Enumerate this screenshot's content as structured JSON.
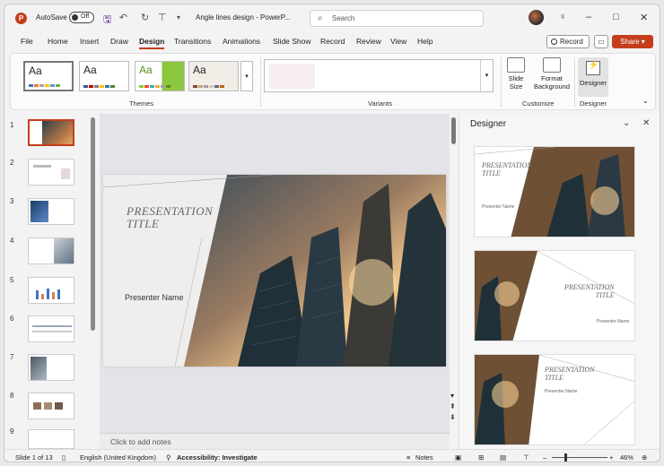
{
  "titlebar": {
    "autosave_label": "AutoSave",
    "autosave_state": "Off",
    "doc_title": "Angle lines design - PowerP...",
    "search_placeholder": "Search",
    "minimize": "–",
    "maximize": "□",
    "close": "✕"
  },
  "tabs": [
    "File",
    "Home",
    "Insert",
    "Draw",
    "Design",
    "Transitions",
    "Animations",
    "Slide Show",
    "Record",
    "Review",
    "View",
    "Help"
  ],
  "active_tab": "Design",
  "actions": {
    "record": "Record",
    "share": "Share"
  },
  "ribbon": {
    "themes_label": "Themes",
    "theme_glyph": "Aa",
    "variants_label": "Variants",
    "customize_label": "Customize",
    "designer_label": "Designer",
    "slide_size": "Slide Size",
    "format_background": "Format Background",
    "designer_button": "Designer"
  },
  "thumbnails": [
    "1",
    "2",
    "3",
    "4",
    "5",
    "6",
    "7",
    "8",
    "9"
  ],
  "slide": {
    "title_line1": "PRESENTATION",
    "title_line2": "TITLE",
    "presenter": "Presenter Name"
  },
  "notes_placeholder": "Click to add notes",
  "designer": {
    "title": "Designer",
    "card_title_line1": "PRESENTATION",
    "card_title_line2": "TITLE",
    "card_presenter": "Presenter Name"
  },
  "status": {
    "slide": "Slide 1 of 13",
    "language": "English (United Kingdom)",
    "accessibility": "Accessibility: Investigate",
    "notes": "Notes",
    "zoom": "46%"
  },
  "colors": {
    "accent": "#c43e1c"
  }
}
